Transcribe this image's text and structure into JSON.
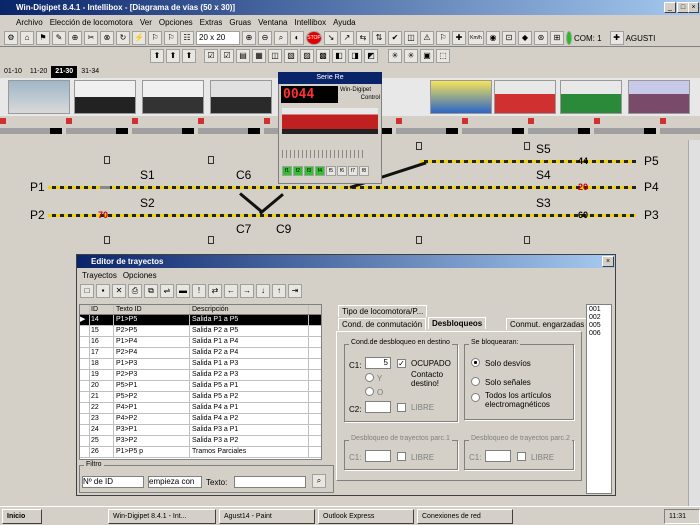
{
  "window": {
    "title": "Win-Digipet 8.4.1 - Intellibox - [Diagrama de vías (50 x 30)]"
  },
  "menu": [
    "Archivo",
    "Elección de locomotora",
    "Ver",
    "Opciones",
    "Extras",
    "Gruas",
    "Ventana",
    "Intellibox",
    "Ayuda"
  ],
  "toolbar": {
    "zoom": "20 x 20",
    "stop": "STOP",
    "com": "COM: 1",
    "user": "AGUSTI",
    "kmh": "Km/h"
  },
  "loco_tabs": [
    "01-10",
    "11-20",
    "21-30",
    "31-34"
  ],
  "loco_panel": {
    "title": "Serie Re",
    "display": "0044",
    "label1": "Win-Digipet",
    "label2": "Control",
    "functions": [
      "f1",
      "f2",
      "f3",
      "f4",
      "f5",
      "f6",
      "f7",
      "f8"
    ]
  },
  "layout": {
    "labels": {
      "p1": "P1",
      "p2": "P2",
      "p3": "P3",
      "p4": "P4",
      "p5": "P5",
      "s1": "S1",
      "s2": "S2",
      "s3": "S3",
      "s4": "S4",
      "s5": "S5",
      "c6": "C6",
      "c7": "C7",
      "c9": "C9"
    },
    "speeds": {
      "a": "70",
      "b": "20",
      "c": "44",
      "d": "60"
    }
  },
  "editor": {
    "title": "Editor de trayectos",
    "menu": [
      "Trayectos",
      "Opciones"
    ],
    "columns": [
      "ID",
      "Texto ID",
      "Descripción"
    ],
    "rows": [
      {
        "id": "14",
        "text": "P1>P5",
        "desc": "Salida P1 a P5"
      },
      {
        "id": "15",
        "text": "P2>P5",
        "desc": "Salida P2 a P5"
      },
      {
        "id": "16",
        "text": "P1>P4",
        "desc": "Salida P1 a P4"
      },
      {
        "id": "17",
        "text": "P2>P4",
        "desc": "Salida P2 a P4"
      },
      {
        "id": "18",
        "text": "P1>P3",
        "desc": "Salida P1 a P3"
      },
      {
        "id": "19",
        "text": "P2>P3",
        "desc": "Salida P2 a P3"
      },
      {
        "id": "20",
        "text": "P5>P1",
        "desc": "Salida P5 a P1"
      },
      {
        "id": "21",
        "text": "P5>P2",
        "desc": "Salida P5 a P2"
      },
      {
        "id": "22",
        "text": "P4>P1",
        "desc": "Salida P4 a P1"
      },
      {
        "id": "23",
        "text": "P4>P2",
        "desc": "Salida P4 a P2"
      },
      {
        "id": "24",
        "text": "P3>P1",
        "desc": "Salida P3 a P1"
      },
      {
        "id": "25",
        "text": "P3>P2",
        "desc": "Salida P3 a P2"
      },
      {
        "id": "26",
        "text": "P1>P5 p",
        "desc": "Tramos Parciales"
      }
    ],
    "tabs_top": [
      "Tipo de locomotora/P..."
    ],
    "tabs": [
      "Cond. de conmutación",
      "Desbloqueos",
      "Conmut. engarzadas"
    ],
    "group_release": "Cond.de desbloqueo en destino",
    "c1_label": "C1:",
    "c1_value": "5",
    "c2_label": "C2:",
    "ocupado": "OCUPADO",
    "contacto": "Contacto",
    "destino": "destino!",
    "y_label": "Y",
    "o_label": "O",
    "libre": "LIBRE",
    "group_block": "Se bloquearan:",
    "opt1": "Solo desvíos",
    "opt2": "Solo señales",
    "opt3a": "Todos los artículos",
    "opt3b": "electromagnéticos",
    "group_p1": "Desbloqueo de trayectos parc.1",
    "group_p2": "Desbloqueo de trayectos parc.2",
    "list": [
      "001",
      "002",
      "005",
      "006"
    ],
    "filter_label": "Filtro",
    "filter_field": "Nº de ID",
    "filter_mode": "empieza con",
    "filter_text": "Texto:"
  },
  "taskbar": {
    "start": "Inicio",
    "tasks": [
      "Win-Digipet 8.4.1 - Int...",
      "Agust14 - Paint",
      "Outlook Express",
      "Conexiones de red"
    ],
    "clock": "11:31"
  }
}
